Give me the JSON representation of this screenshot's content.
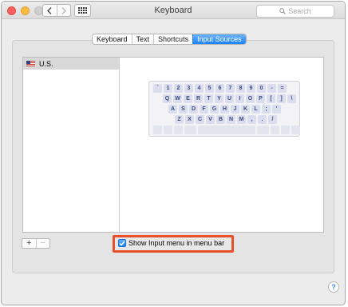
{
  "window": {
    "title": "Keyboard",
    "search_placeholder": "Search"
  },
  "tabs": [
    {
      "label": "Keyboard",
      "active": false
    },
    {
      "label": "Text",
      "active": false
    },
    {
      "label": "Shortcuts",
      "active": false
    },
    {
      "label": "Input Sources",
      "active": true
    }
  ],
  "sources": [
    {
      "label": "U.S.",
      "icon": "us-flag-icon",
      "selected": true
    }
  ],
  "keyboard_rows": [
    [
      "`",
      "1",
      "2",
      "3",
      "4",
      "5",
      "6",
      "7",
      "8",
      "9",
      "0",
      "-",
      "="
    ],
    [
      "Q",
      "W",
      "E",
      "R",
      "T",
      "Y",
      "U",
      "I",
      "O",
      "P",
      "[",
      "]",
      "\\"
    ],
    [
      "A",
      "S",
      "D",
      "F",
      "G",
      "H",
      "J",
      "K",
      "L",
      ";",
      "'"
    ],
    [
      "Z",
      "X",
      "C",
      "V",
      "B",
      "N",
      "M",
      ",",
      ".",
      "/"
    ]
  ],
  "list_buttons": {
    "add": "+",
    "remove": "−"
  },
  "show_input_menu": {
    "label": "Show Input menu in menu bar",
    "checked": true
  },
  "help": "?",
  "colors": {
    "accent": "#1a82fb",
    "highlight": "#e8502c",
    "key_fill": "#d9dded",
    "key_text": "#3d4a7b"
  }
}
